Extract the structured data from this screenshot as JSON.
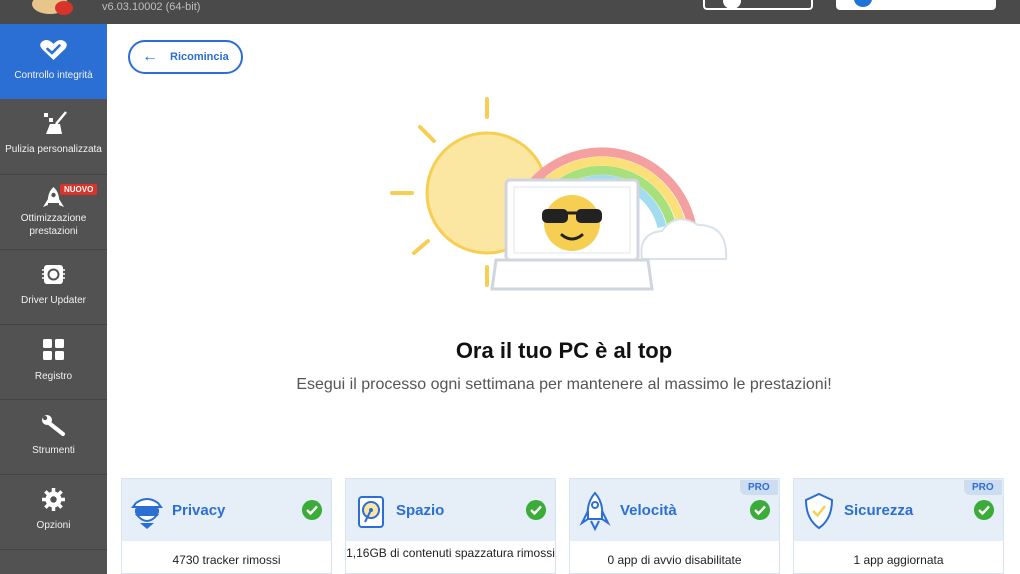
{
  "app": {
    "version": "v6.03.10002 (64-bit)"
  },
  "sidebar": {
    "items": [
      {
        "label": "Controllo integrità",
        "icon": "heart-check-icon",
        "active": true
      },
      {
        "label": "Pulizia personalizzata",
        "icon": "broom-icon"
      },
      {
        "label": "Ottimizzazione prestazioni",
        "icon": "rocket-icon",
        "badge": "NUOVO"
      },
      {
        "label": "Driver Updater",
        "icon": "chip-icon"
      },
      {
        "label": "Registro",
        "icon": "grid-icon"
      },
      {
        "label": "Strumenti",
        "icon": "wrench-icon"
      },
      {
        "label": "Opzioni",
        "icon": "gear-icon"
      }
    ]
  },
  "main": {
    "restart_label": "Ricomincia",
    "headline": "Ora il tuo PC è al top",
    "subline": "Esegui il processo ogni settimana per mantenere al massimo le prestazioni!"
  },
  "cards": [
    {
      "title": "Privacy",
      "icon": "spy-icon",
      "body": "4730 tracker rimossi",
      "pro": false
    },
    {
      "title": "Spazio",
      "icon": "disk-icon",
      "body": "1,16GB di contenuti spazzatura rimossi",
      "pro": false
    },
    {
      "title": "Velocità",
      "icon": "rocket-icon",
      "body": "0 app di avvio disabilitate",
      "pro": true,
      "pro_label": "PRO"
    },
    {
      "title": "Sicurezza",
      "icon": "shield-icon",
      "body": "1 app aggiornata",
      "pro": true,
      "pro_label": "PRO"
    }
  ],
  "colors": {
    "accent": "#2b6fd4",
    "sidebar": "#525252",
    "topbar": "#4a4a4a",
    "success": "#3bab3a",
    "badge": "#d9332a"
  }
}
